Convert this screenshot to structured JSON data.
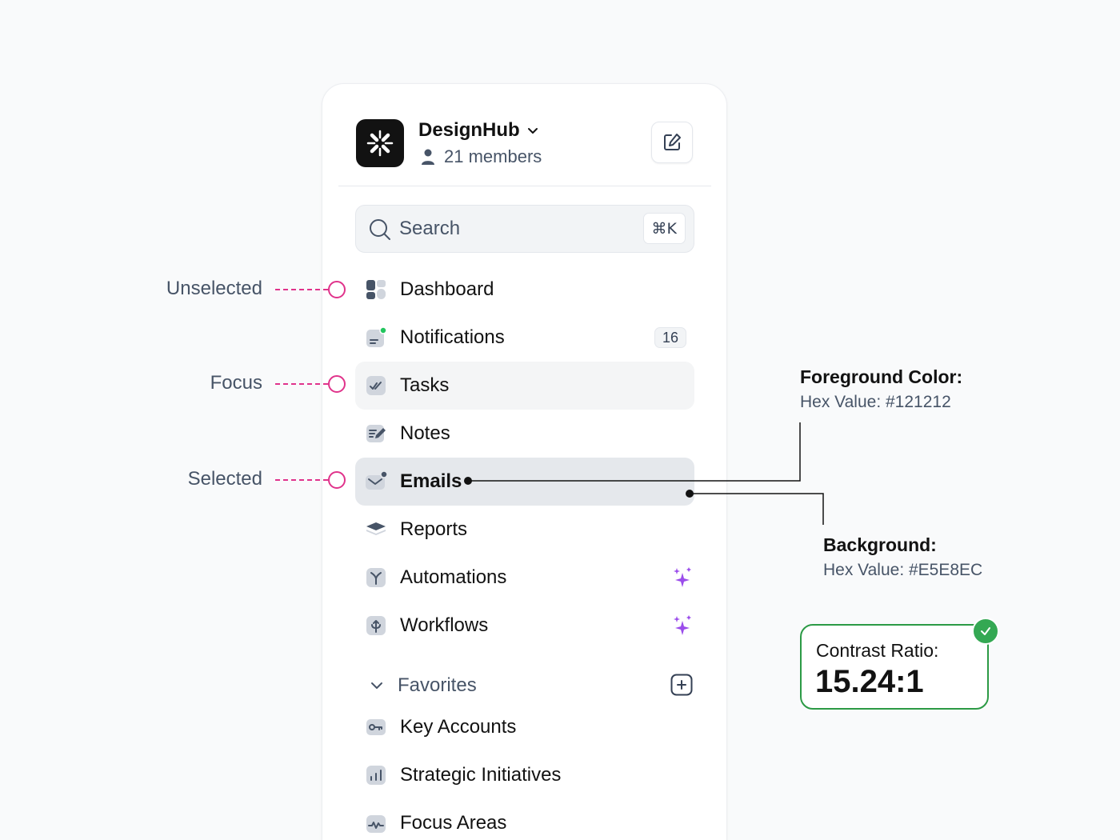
{
  "workspace": {
    "name": "DesignHub",
    "members": "21 members"
  },
  "search": {
    "placeholder": "Search",
    "shortcut": "⌘K"
  },
  "nav": {
    "dashboard": "Dashboard",
    "notifications": "Notifications",
    "notifications_count": "16",
    "tasks": "Tasks",
    "notes": "Notes",
    "emails": "Emails",
    "reports": "Reports",
    "automations": "Automations",
    "workflows": "Workflows"
  },
  "favorites": {
    "title": "Favorites",
    "items": [
      "Key Accounts",
      "Strategic Initiatives",
      "Focus Areas"
    ]
  },
  "states": {
    "unselected": "Unselected",
    "focus": "Focus",
    "selected": "Selected"
  },
  "foreground": {
    "title": "Foreground Color:",
    "hex": "Hex Value: #121212"
  },
  "background": {
    "title": "Background:",
    "hex": "Hex Value: #E5E8EC"
  },
  "contrast": {
    "label": "Contrast Ratio:",
    "value": "15.24:1"
  },
  "colors": {
    "foreground": "#121212",
    "selected_bg": "#E5E8EC",
    "focus_bg": "#F4F5F6",
    "annotation_accent": "#E0338B",
    "success": "#34A853",
    "sparkle": "#9B4DEB"
  }
}
